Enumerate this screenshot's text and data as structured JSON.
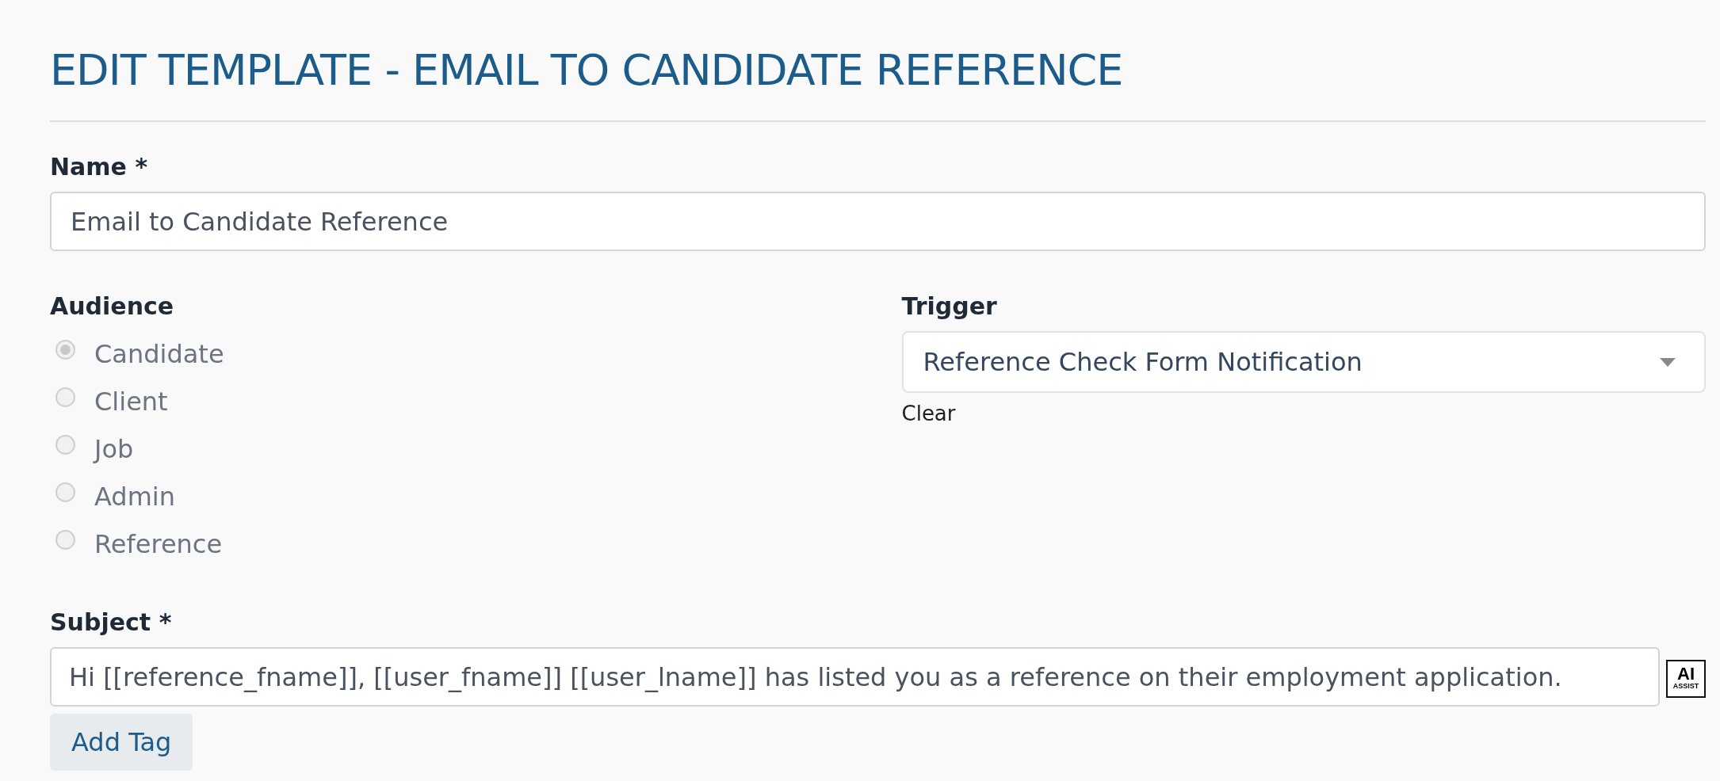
{
  "page": {
    "title": "EDIT TEMPLATE - EMAIL TO CANDIDATE REFERENCE"
  },
  "name_field": {
    "label": "Name *",
    "value": "Email to Candidate Reference"
  },
  "audience": {
    "label": "Audience",
    "disabled": true,
    "options": [
      {
        "label": "Candidate",
        "selected": true
      },
      {
        "label": "Client",
        "selected": false
      },
      {
        "label": "Job",
        "selected": false
      },
      {
        "label": "Admin",
        "selected": false
      },
      {
        "label": "Reference",
        "selected": false
      }
    ]
  },
  "trigger": {
    "label": "Trigger",
    "value": "Reference Check Form Notification",
    "clear_link": "Clear"
  },
  "subject": {
    "label": "Subject *",
    "value": "Hi [[reference_fname]], [[user_fname]] [[user_lname]] has listed you as a reference on their employment application.",
    "ai_button": {
      "title": "AI",
      "caption": "ASSIST"
    },
    "add_tag_button": "Add Tag"
  }
}
